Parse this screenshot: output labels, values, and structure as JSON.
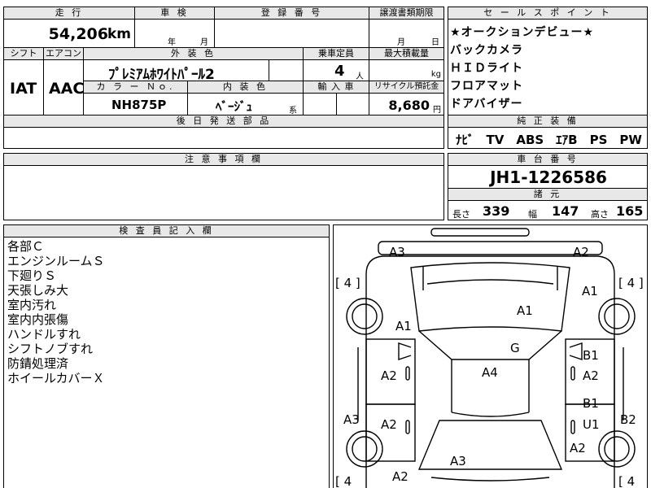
{
  "top": {
    "mileage_header": "走 行",
    "mileage_value": "54,206",
    "mileage_unit": "km",
    "inspection_header": "車 検",
    "inspection_year": "年",
    "inspection_month": "月",
    "registration_header": "登 録 番 号",
    "transfer_header": "譲渡書類期限",
    "transfer_month": "月",
    "transfer_day": "日"
  },
  "row2": {
    "shift_header": "シフト",
    "ac_header": "エアコン",
    "exterior_header": "外 装 色",
    "capacity_header": "乗車定員",
    "maxload_header": "最大積載量",
    "shift_value": "IAT",
    "ac_value": "AAC",
    "exterior_value": "ﾌﾟﾚﾐｱﾑﾎﾜｲﾄﾊﾟｰﾙ2",
    "capacity_value": "4",
    "capacity_unit": "人",
    "maxload_unit": "kg",
    "color_no_header": "カ ラ ー Ｎｏ.",
    "interior_header": "内 装 色",
    "import_header": "輸 入 車",
    "recycle_header": "リサイクル預託金",
    "color_no_value": "NH875P",
    "interior_value": "ﾍﾞｰｼﾞｭ",
    "interior_suffix": "系",
    "recycle_value": "8,680",
    "recycle_unit": "円",
    "later_parts_header": "後 日 発 送 部 品"
  },
  "sales_points": {
    "header": "セ ー ル ス ポ イ ン ト",
    "items": [
      "★オークションデビュー★",
      "バックカメラ",
      "ＨＩＤライト",
      "フロアマット",
      "ドアバイザー"
    ]
  },
  "genuine": {
    "header": "純 正 装 備",
    "value": "ﾅﾋﾞ　TV　ABS　ｴｱB　PS　PW"
  },
  "notes_header": "注 意 事 項 欄",
  "chassis": {
    "header": "車 台 番 号",
    "value": "JH1-1226586",
    "specs_header": "諸 元",
    "length_label": "長さ",
    "length_value": "339",
    "width_label": "幅",
    "width_value": "147",
    "height_label": "高さ",
    "height_value": "165"
  },
  "inspector": {
    "header": "検 査 員 記 入 欄",
    "lines": [
      "各部Ｃ",
      "エンジンルームＳ",
      "下廻りＳ",
      "天張しみ大",
      "室内汚れ",
      "室内内張傷",
      "ハンドルすれ",
      "シフトノブすれ",
      "防錆処理済",
      "ホイールカバーＸ"
    ]
  },
  "diagram": {
    "tire_fl": "[ 4 ]",
    "tire_fr": "[ 4 ]",
    "tire_rl": "[ 4",
    "tire_rr": "[ 4",
    "marks": {
      "front_left_corner": "A3",
      "front_right_corner": "A2",
      "right_fender": "A1",
      "hood": "A1",
      "left_fender": "A1",
      "roof_front": "G",
      "left_front_door": "A2",
      "roof": "A4",
      "right_pillar": "B1",
      "right_front_door": "A2",
      "right_rear_pillar": "B1",
      "right_rear_door": "U1",
      "left_sill": "A3",
      "left_rear_door": "A2",
      "right_quarter": "B2",
      "rear_hatch": "A3",
      "right_rear_fender": "A2",
      "left_rear_fender": "A2"
    }
  }
}
